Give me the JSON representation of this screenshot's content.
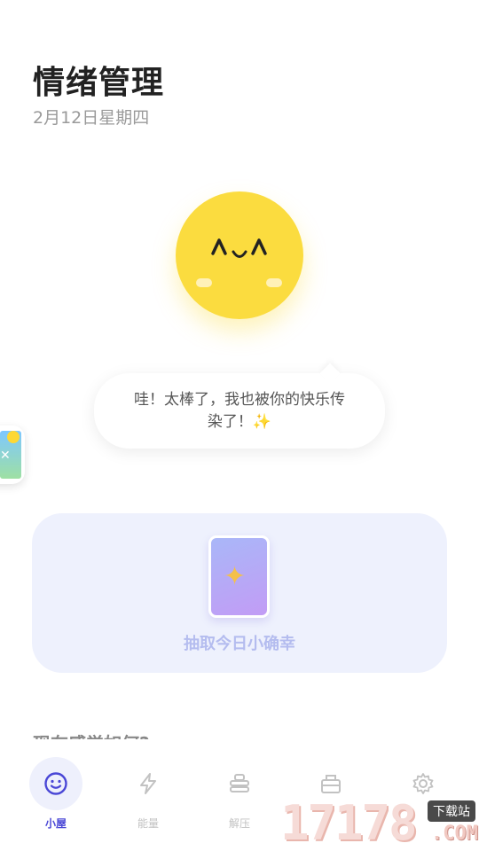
{
  "header": {
    "title": "情绪管理",
    "date": "2月12日星期四"
  },
  "mascot": {
    "face": "^ᴗ^",
    "color": "#fbdc3f"
  },
  "bubble": {
    "line1": "哇！太棒了，我也被你的快乐传",
    "line2": "染了！",
    "emoji_icon": "sparkles-icon",
    "emoji": "✨"
  },
  "luck_card": {
    "label": "抽取今日小确幸",
    "card_icon": "sparkles-icon",
    "card_glyph": "✦"
  },
  "section": {
    "title": "现在感觉如何?"
  },
  "tabs": [
    {
      "label": "小屋",
      "icon": "smiley-icon",
      "active": true
    },
    {
      "label": "能量",
      "icon": "lightning-icon",
      "active": false
    },
    {
      "label": "解压",
      "icon": "stack-icon",
      "active": false
    },
    {
      "label": "",
      "icon": "briefcase-icon",
      "active": false
    },
    {
      "label": "",
      "icon": "gear-icon",
      "active": false
    }
  ],
  "watermark": {
    "number": "17178",
    "tag": "下载站",
    "suffix": ".COM"
  },
  "colors": {
    "accent": "#4a47d6",
    "card_bg": "#eef1fd",
    "mascot": "#fbdc3f"
  }
}
